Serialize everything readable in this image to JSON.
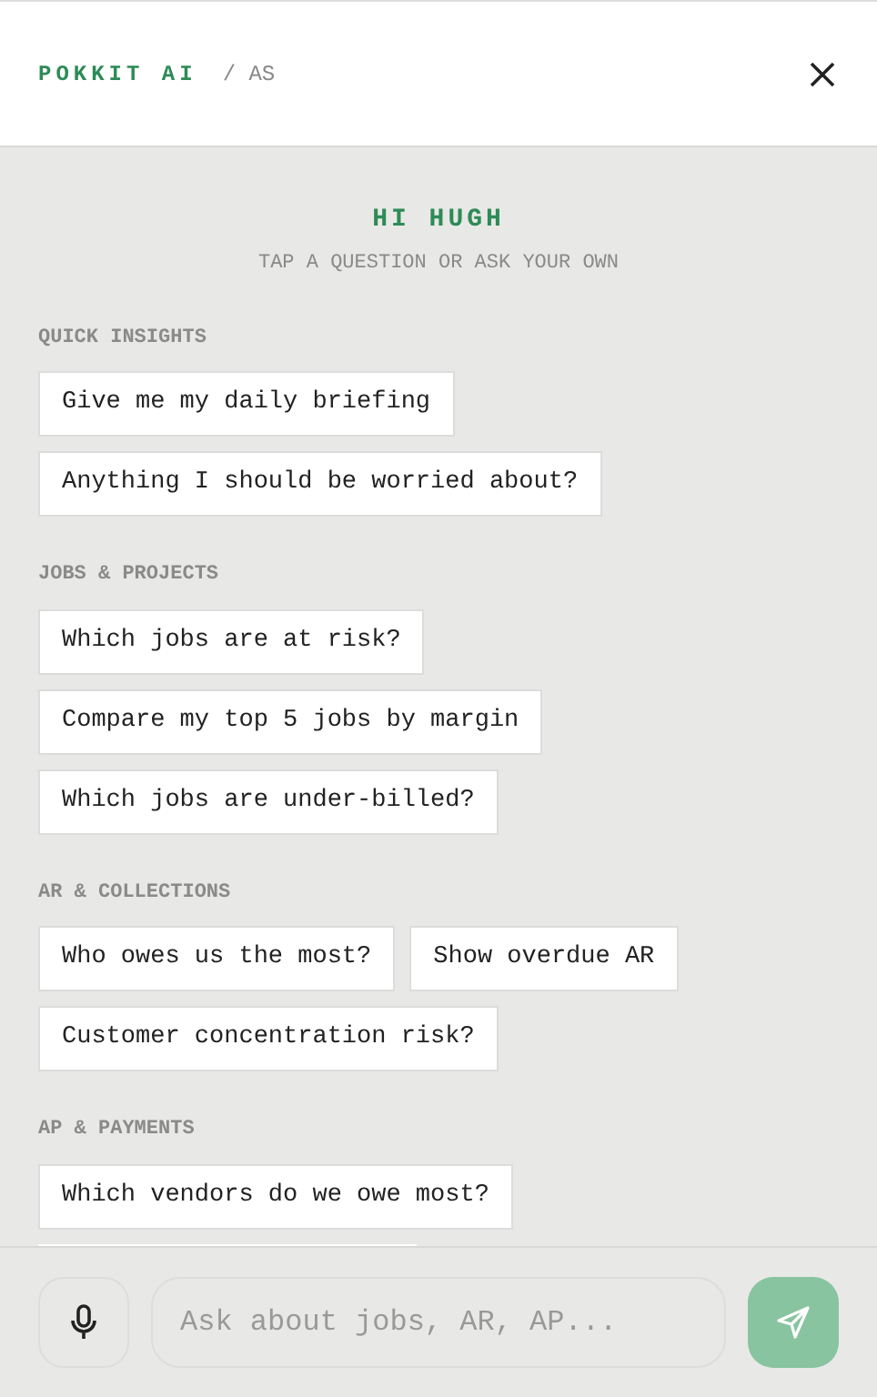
{
  "header": {
    "brand": "POKKIT AI",
    "context": "/ AS"
  },
  "greeting": {
    "title": "HI HUGH",
    "subtitle": "TAP A QUESTION OR ASK YOUR OWN"
  },
  "sections": [
    {
      "title": "QUICK INSIGHTS",
      "chips": [
        "Give me my daily briefing",
        "Anything I should be worried about?"
      ]
    },
    {
      "title": "JOBS & PROJECTS",
      "chips": [
        "Which jobs are at risk?",
        "Compare my top 5 jobs by margin",
        "Which jobs are under-billed?"
      ]
    },
    {
      "title": "AR & COLLECTIONS",
      "chips": [
        "Who owes us the most?",
        "Show overdue AR",
        "Customer concentration risk?"
      ]
    },
    {
      "title": "AP & PAYMENTS",
      "chips": [
        "Which vendors do we owe most?"
      ],
      "cut_chip": true
    }
  ],
  "input": {
    "placeholder": "Ask about jobs, AR, AP..."
  },
  "send": {
    "disabled": true
  }
}
